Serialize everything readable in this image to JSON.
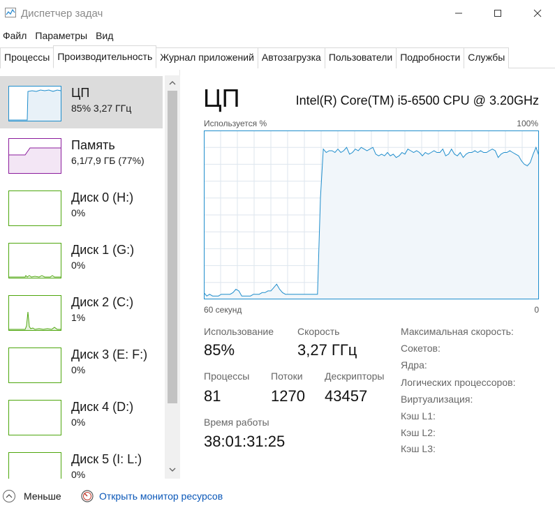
{
  "window": {
    "title": "Диспетчер задач"
  },
  "menu": [
    "Файл",
    "Параметры",
    "Вид"
  ],
  "tabs": [
    {
      "label": "Процессы",
      "active": false
    },
    {
      "label": "Производительность",
      "active": true
    },
    {
      "label": "Журнал приложений",
      "active": false
    },
    {
      "label": "Автозагрузка",
      "active": false
    },
    {
      "label": "Пользователи",
      "active": false
    },
    {
      "label": "Подробности",
      "active": false
    },
    {
      "label": "Службы",
      "active": false
    }
  ],
  "resources": [
    {
      "name": "ЦП",
      "value": "85% 3,27 ГГц",
      "color": "#1e8dcc",
      "selected": true
    },
    {
      "name": "Память",
      "value": "6,1/7,9 ГБ (77%)",
      "color": "#8b1b9c",
      "selected": false
    },
    {
      "name": "Диск 0 (H:)",
      "value": "0%",
      "color": "#4da60c",
      "selected": false
    },
    {
      "name": "Диск 1 (G:)",
      "value": "0%",
      "color": "#4da60c",
      "selected": false
    },
    {
      "name": "Диск 2 (C:)",
      "value": "1%",
      "color": "#4da60c",
      "selected": false
    },
    {
      "name": "Диск 3 (E: F:)",
      "value": "0%",
      "color": "#4da60c",
      "selected": false
    },
    {
      "name": "Диск 4 (D:)",
      "value": "0%",
      "color": "#4da60c",
      "selected": false
    },
    {
      "name": "Диск 5 (I: L:)",
      "value": "0%",
      "color": "#4da60c",
      "selected": false
    }
  ],
  "detail": {
    "title": "ЦП",
    "model": "Intel(R) Core(TM) i5-6500 CPU @ 3.20GHz",
    "graph_label": "Используется %",
    "graph_max": "100%",
    "axis_left": "60 секунд",
    "axis_right": "0",
    "stats": {
      "usage_label": "Использование",
      "usage_value": "85%",
      "speed_label": "Скорость",
      "speed_value": "3,27 ГГц",
      "processes_label": "Процессы",
      "processes_value": "81",
      "threads_label": "Потоки",
      "threads_value": "1270",
      "handles_label": "Дескрипторы",
      "handles_value": "43457",
      "uptime_label": "Время работы",
      "uptime_value": "38:01:31:25"
    },
    "info": [
      "Максимальная скорость:",
      "Сокетов:",
      "Ядра:",
      "Логических процессоров:",
      "Виртуализация:",
      "Кэш L1:",
      "Кэш L2:",
      "Кэш L3:"
    ]
  },
  "cpu_history": [
    4,
    2,
    3,
    2,
    2,
    2,
    3,
    3,
    3,
    3,
    4,
    6,
    5,
    2,
    2,
    2,
    2,
    3,
    3,
    3,
    4,
    4,
    5,
    5,
    7,
    9,
    6,
    4,
    3,
    3,
    3,
    3,
    3,
    3,
    3,
    3,
    3,
    3,
    3,
    3,
    60,
    89,
    87,
    88,
    88,
    87,
    89,
    87,
    88,
    90,
    86,
    87,
    89,
    88,
    90,
    89,
    88,
    89,
    90,
    86,
    85,
    86,
    85,
    87,
    85,
    86,
    84,
    85,
    87,
    86,
    89,
    88,
    87,
    88,
    87,
    85,
    87,
    86,
    87,
    88,
    87,
    87,
    89,
    85,
    86,
    89,
    86,
    85,
    87,
    84,
    86,
    87,
    87,
    88,
    87,
    88,
    87,
    87,
    88,
    89,
    88,
    84,
    86,
    87,
    87,
    88,
    87,
    86,
    85,
    82,
    80,
    79,
    81,
    86,
    90,
    85
  ],
  "bottom": {
    "less_label": "Меньше",
    "monitor_label": "Открыть монитор ресурсов"
  },
  "colors": {
    "cpu": "#1e8dcc",
    "cpu_fill": "#f1f6fa",
    "grid": "#dde6ee",
    "memory": "#8b1b9c",
    "disk": "#4da60c",
    "link": "#0a57b8"
  }
}
